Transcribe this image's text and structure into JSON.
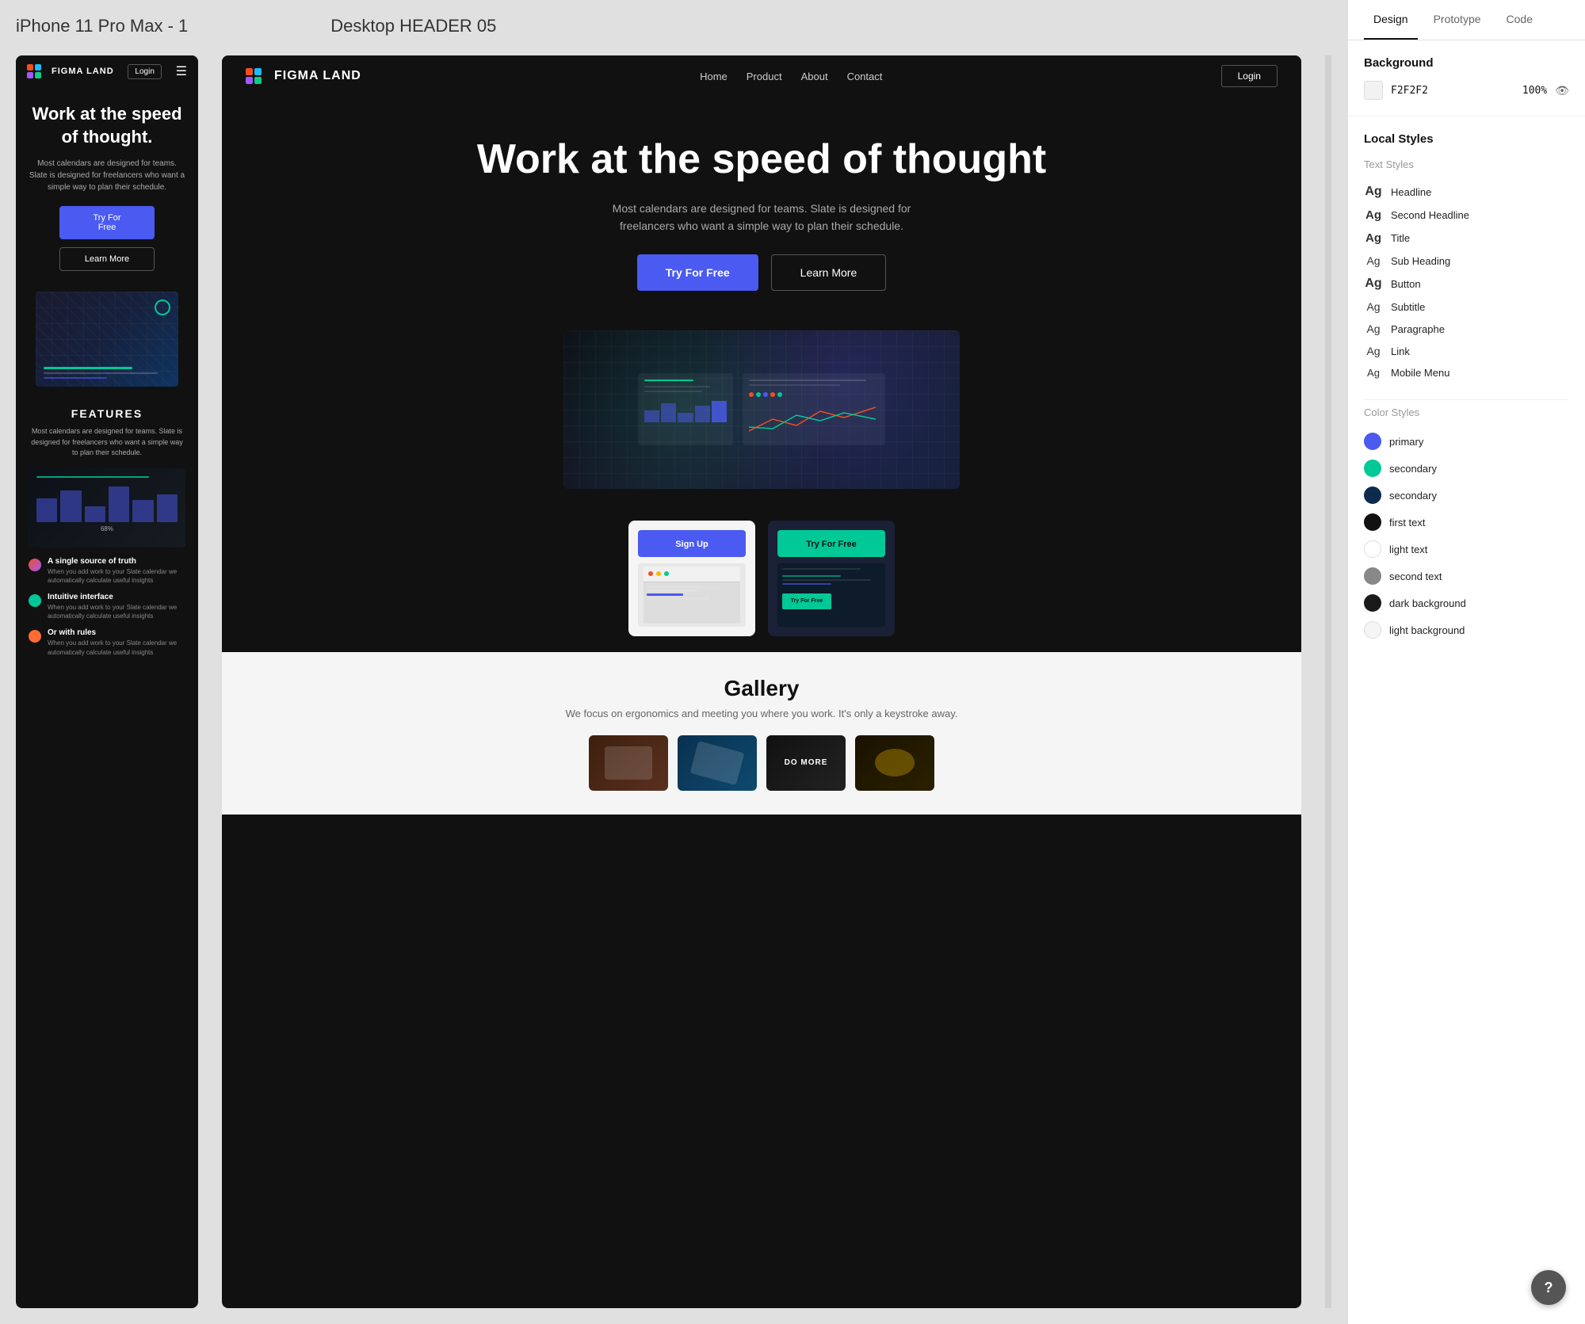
{
  "frame_labels": {
    "iphone": "iPhone 11 Pro Max - 1",
    "desktop": "Desktop HEADER 05"
  },
  "panel_tabs": {
    "design": "Design",
    "prototype": "Prototype",
    "code": "Code",
    "active": "design"
  },
  "background_section": {
    "title": "Background",
    "color_value": "F2F2F2",
    "opacity": "100%"
  },
  "local_styles": {
    "title": "Local Styles",
    "text_styles_label": "Text Styles",
    "text_styles": [
      {
        "ag": "Ag",
        "weight": "bold",
        "name": "Headline"
      },
      {
        "ag": "Ag",
        "weight": "medium",
        "name": "Second Headline"
      },
      {
        "ag": "Ag",
        "weight": "medium",
        "name": "Title"
      },
      {
        "ag": "Ag",
        "weight": "normal",
        "name": "Sub Heading"
      },
      {
        "ag": "Ag",
        "weight": "bold",
        "name": "Button"
      },
      {
        "ag": "Ag",
        "weight": "normal",
        "name": "Subtitle"
      },
      {
        "ag": "Ag",
        "weight": "normal",
        "name": "Paragraphe"
      },
      {
        "ag": "Ag",
        "weight": "normal",
        "name": "Link"
      },
      {
        "ag": "Ag",
        "weight": "light",
        "name": "Mobile Menu"
      }
    ],
    "color_styles_label": "Color Styles",
    "color_styles": [
      {
        "name": "primary",
        "color": "#4B5AF0",
        "type": "circle"
      },
      {
        "name": "secondary",
        "color": "#00C896",
        "type": "circle"
      },
      {
        "name": "secondary",
        "color": "#0D2B4E",
        "type": "circle"
      },
      {
        "name": "first text",
        "color": "#111111",
        "type": "circle"
      },
      {
        "name": "light text",
        "color": "#ffffff",
        "type": "white-circle"
      },
      {
        "name": "second text",
        "color": "#888888",
        "type": "circle"
      },
      {
        "name": "dark background",
        "color": "#1a1a1a",
        "type": "circle"
      },
      {
        "name": "light background",
        "color": "#f5f5f5",
        "type": "circle-light"
      }
    ]
  },
  "iphone": {
    "nav": {
      "logo": "FIGMA LAND",
      "login_btn": "Login"
    },
    "hero": {
      "headline": "Work at the speed of thought.",
      "subtitle": "Most calendars are designed for teams. Slate is designed for freelancers who want a simple way to plan their schedule.",
      "btn_primary": "Try For Free",
      "btn_secondary": "Learn More"
    },
    "features": {
      "title": "FEATURES",
      "subtitle": "Most calendars are designed for teams. Slate is designed for freelancers who want a simple way to plan their schedule.",
      "items": [
        {
          "title": "A single source of truth",
          "desc": "When you add work to your Slate calendar we automatically calculate useful insights"
        },
        {
          "title": "Intuitive interface",
          "desc": "When you add work to your Slate calendar we automatically calculate useful insights"
        },
        {
          "title": "Or with rules",
          "desc": "When you add work to your Slate calendar we automatically calculate useful insights"
        }
      ]
    }
  },
  "desktop": {
    "nav": {
      "logo": "FIGMA LAND",
      "links": [
        "Home",
        "Product",
        "About",
        "Contact"
      ],
      "login_btn": "Login"
    },
    "hero": {
      "headline": "Work at the speed of thought",
      "subtitle": "Most calendars are designed for teams. Slate is designed for freelancers who want a simple way to plan their schedule.",
      "btn_primary": "Try For Free",
      "btn_secondary": "Learn More"
    },
    "gallery": {
      "title": "Gallery",
      "subtitle": "We focus on ergonomics and meeting you where you work. It's only a keystroke away.",
      "sign_up_btn": "Sign Up",
      "try_free_btn": "Try For Free"
    }
  },
  "help_btn": "?"
}
